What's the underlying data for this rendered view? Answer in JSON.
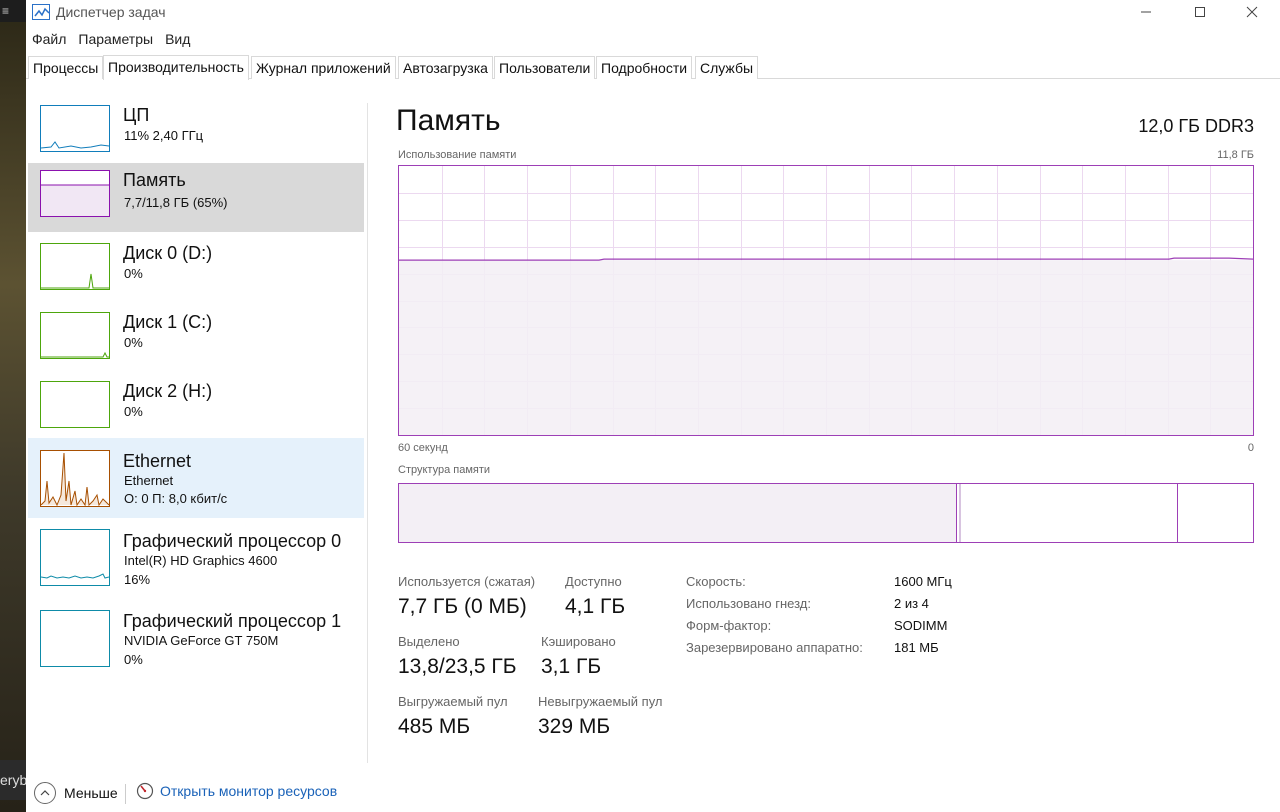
{
  "window": {
    "title": "Диспетчер задач"
  },
  "menu": [
    "Файл",
    "Параметры",
    "Вид"
  ],
  "tabs": [
    "Процессы",
    "Производительность",
    "Журнал приложений",
    "Автозагрузка",
    "Пользователи",
    "Подробности",
    "Службы"
  ],
  "active_tab": "Производительность",
  "sidebar": {
    "items": [
      {
        "name": "ЦП",
        "sub1": "11% 2,40 ГГц",
        "sub2": "",
        "sub3": "",
        "color": "#117dbb",
        "icon": "cpu-graph"
      },
      {
        "name": "Память",
        "sub1": "7,7/11,8 ГБ (65%)",
        "sub2": "",
        "sub3": "",
        "color": "#8b12ae",
        "icon": "memory-graph"
      },
      {
        "name": "Диск 0 (D:)",
        "sub1": "0%",
        "sub2": "",
        "sub3": "",
        "color": "#4da60c",
        "icon": "disk-graph"
      },
      {
        "name": "Диск 1 (C:)",
        "sub1": "0%",
        "sub2": "",
        "sub3": "",
        "color": "#4da60c",
        "icon": "disk-graph"
      },
      {
        "name": "Диск 2 (H:)",
        "sub1": "0%",
        "sub2": "",
        "sub3": "",
        "color": "#4da60c",
        "icon": "disk-graph"
      },
      {
        "name": "Ethernet",
        "sub1": "Ethernet",
        "sub2": "О: 0 П: 8,0 кбит/с",
        "sub3": "",
        "color": "#a74f01",
        "icon": "network-graph"
      },
      {
        "name": "Графический процессор 0",
        "sub1": "Intel(R) HD Graphics 4600",
        "sub2": "16%",
        "sub3": "",
        "color": "#0e8ba8",
        "icon": "gpu-graph"
      },
      {
        "name": "Графический процессор 1",
        "sub1": "NVIDIA GeForce GT 750M",
        "sub2": "0%",
        "sub3": "",
        "color": "#0e8ba8",
        "icon": "gpu-graph"
      }
    ],
    "selected_index": 1
  },
  "memory": {
    "title": "Память",
    "spec": "12,0 ГБ DDR3",
    "usage_label": "Использование памяти",
    "usage_max": "11,8 ГБ",
    "time_left": "60 секунд",
    "time_right": "0",
    "usage_fraction": 0.65,
    "structure_label": "Структура памяти",
    "structure": {
      "in_use_fraction": 0.652,
      "standby_end_fraction": 0.91
    },
    "stats": {
      "in_use_label": "Используется (сжатая)",
      "in_use_value": "7,7 ГБ (0 МБ)",
      "available_label": "Доступно",
      "available_value": "4,1 ГБ",
      "committed_label": "Выделено",
      "committed_value": "13,8/23,5 ГБ",
      "cached_label": "Кэшировано",
      "cached_value": "3,1 ГБ",
      "paged_label": "Выгружаемый пул",
      "paged_value": "485 МБ",
      "nonpaged_label": "Невыгружаемый пул",
      "nonpaged_value": "329 МБ"
    },
    "details": [
      {
        "label": "Скорость:",
        "value": "1600 МГц"
      },
      {
        "label": "Использовано гнезд:",
        "value": "2 из 4"
      },
      {
        "label": "Форм-фактор:",
        "value": "SODIMM"
      },
      {
        "label": "Зарезервировано аппаратно:",
        "value": "181 МБ"
      }
    ]
  },
  "footer": {
    "fewer": "Меньше",
    "resource_monitor": "Открыть монитор ресурсов"
  },
  "colors": {
    "memory_accent": "#9d3fb6",
    "memory_fill": "#f3eff5",
    "grid": "#ecd9f0"
  }
}
